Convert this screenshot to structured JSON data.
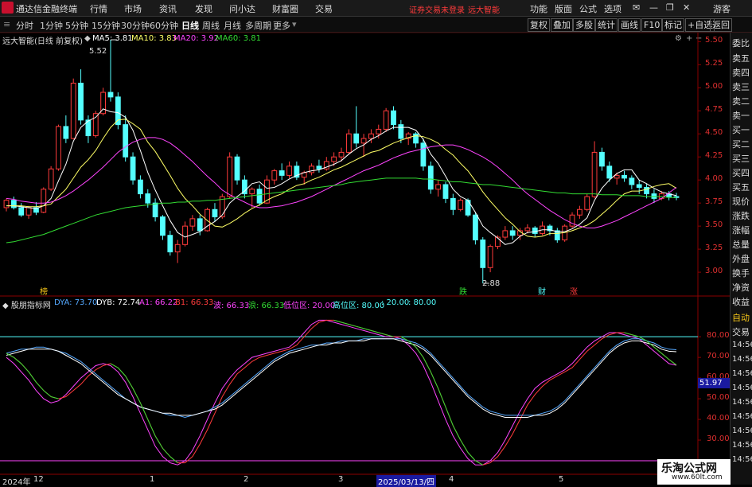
{
  "menubar": {
    "app_title": "通达信金融终端",
    "items": [
      "行情",
      "市场",
      "资讯",
      "发现",
      "问小达",
      "财富圈",
      "交易"
    ],
    "notice": "证券交易未登录",
    "stock_name": "远大智能",
    "right_items": [
      "功能",
      "版面",
      "公式",
      "选项"
    ],
    "user": "游客"
  },
  "toolbar": {
    "periods": [
      "分时",
      "1分钟",
      "5分钟",
      "15分钟",
      "30分钟",
      "60分钟",
      "日线",
      "周线",
      "月线",
      "多周期",
      "更多"
    ],
    "active": "日线",
    "right_buttons": [
      "复权",
      "叠加",
      "多股",
      "统计",
      "画线",
      "F10",
      "标记",
      "+自选",
      "返回"
    ]
  },
  "main_header": {
    "title": "远大智能(日线 前复权)",
    "ma5": "MA5: 3.81",
    "ma10": "MA10: 3.83",
    "ma20": "MA20: 3.92",
    "ma60": "MA60: 3.81"
  },
  "indicator_header": {
    "name": "股朋指标网",
    "dya": "DYA: 73.70",
    "dyb": "DYB: 72.74",
    "a1": "A1: 66.22",
    "b1": "B1: 66.33",
    "z1": "波: 66.33",
    "z2": "浪: 66.33",
    "low_zone": "低位区: 20.00",
    "high_zone": "高位区: 80.00",
    "v1": ": 20.00",
    "v2": ": 80.00"
  },
  "price_axis": [
    "5.50",
    "5.25",
    "5.00",
    "4.75",
    "4.50",
    "4.25",
    "4.00",
    "3.75",
    "3.50",
    "3.25",
    "3.00"
  ],
  "indicator_axis": [
    "80.00",
    "70.00",
    "60.00",
    "50.00",
    "40.00",
    "30.00"
  ],
  "indicator_current": "51.97",
  "annotations": {
    "high_label": "5.52",
    "low_label": "2.88",
    "tag1": "榜",
    "tag2": "跌",
    "tag3": "财",
    "tag4": "涨"
  },
  "date_axis": [
    "2024年",
    "12",
    "1",
    "2",
    "3",
    "2025/03/13/四",
    "4",
    "5"
  ],
  "right_panel": {
    "items": [
      "委比",
      "卖五",
      "卖四",
      "卖三",
      "卖二",
      "卖一",
      "买一",
      "买二",
      "买三",
      "买四",
      "买五",
      "现价",
      "涨跌",
      "涨幅",
      "总量",
      "外盘",
      "换手",
      "净资",
      "收益"
    ],
    "tabs": [
      "自动",
      "交易"
    ],
    "times": [
      "14:56",
      "14:56",
      "14:56",
      "14:56",
      "14:56",
      "14:56",
      "14:56",
      "14:56",
      "14:56"
    ]
  },
  "watermark": {
    "line1": "乐淘公式网",
    "line2": "www.60lt.com"
  },
  "colors": {
    "up": "#ff3b3b",
    "down": "#54ffff",
    "ma5": "#ffffff",
    "ma10": "#ffff66",
    "ma20": "#ff44ff",
    "ma60": "#33dd33"
  },
  "chart_data": {
    "type": "candlestick",
    "price_ylim": [
      2.88,
      5.52
    ],
    "ohlc": [
      [
        3.7,
        3.8,
        3.66,
        3.78
      ],
      [
        3.78,
        3.82,
        3.68,
        3.7
      ],
      [
        3.7,
        3.75,
        3.6,
        3.62
      ],
      [
        3.62,
        3.72,
        3.58,
        3.7
      ],
      [
        3.7,
        3.76,
        3.62,
        3.65
      ],
      [
        3.65,
        3.92,
        3.64,
        3.9
      ],
      [
        3.9,
        4.15,
        3.88,
        4.12
      ],
      [
        4.12,
        4.6,
        4.1,
        4.58
      ],
      [
        4.58,
        4.7,
        4.4,
        4.45
      ],
      [
        4.45,
        5.1,
        4.44,
        5.05
      ],
      [
        5.05,
        5.2,
        4.6,
        4.65
      ],
      [
        4.65,
        4.7,
        4.4,
        4.48
      ],
      [
        4.48,
        4.75,
        4.46,
        4.72
      ],
      [
        4.72,
        5.0,
        4.7,
        4.95
      ],
      [
        4.95,
        5.52,
        4.85,
        4.9
      ],
      [
        4.9,
        4.95,
        4.55,
        4.6
      ],
      [
        4.6,
        4.7,
        4.2,
        4.25
      ],
      [
        4.25,
        4.3,
        3.95,
        4.0
      ],
      [
        4.0,
        4.05,
        3.8,
        3.85
      ],
      [
        3.85,
        3.9,
        3.7,
        3.75
      ],
      [
        3.75,
        3.8,
        3.55,
        3.6
      ],
      [
        3.6,
        3.62,
        3.35,
        3.4
      ],
      [
        3.4,
        3.45,
        3.18,
        3.22
      ],
      [
        3.22,
        3.35,
        3.1,
        3.3
      ],
      [
        3.3,
        3.55,
        3.28,
        3.5
      ],
      [
        3.5,
        3.62,
        3.45,
        3.58
      ],
      [
        3.58,
        3.62,
        3.4,
        3.45
      ],
      [
        3.45,
        3.7,
        3.44,
        3.68
      ],
      [
        3.68,
        3.75,
        3.55,
        3.6
      ],
      [
        3.6,
        3.85,
        3.58,
        3.82
      ],
      [
        3.82,
        4.3,
        3.8,
        4.25
      ],
      [
        4.25,
        4.28,
        3.95,
        4.0
      ],
      [
        4.0,
        4.05,
        3.8,
        3.85
      ],
      [
        3.85,
        3.92,
        3.7,
        3.9
      ],
      [
        3.9,
        3.95,
        3.72,
        3.75
      ],
      [
        3.75,
        4.05,
        3.74,
        4.0
      ],
      [
        4.0,
        4.12,
        3.95,
        4.1
      ],
      [
        4.1,
        4.18,
        4.0,
        4.05
      ],
      [
        4.05,
        4.2,
        4.02,
        4.15
      ],
      [
        4.15,
        4.2,
        4.0,
        4.03
      ],
      [
        4.03,
        4.1,
        3.95,
        4.08
      ],
      [
        4.08,
        4.18,
        4.05,
        4.15
      ],
      [
        4.15,
        4.22,
        4.08,
        4.12
      ],
      [
        4.12,
        4.25,
        4.1,
        4.2
      ],
      [
        4.2,
        4.3,
        4.15,
        4.25
      ],
      [
        4.25,
        4.35,
        4.2,
        4.3
      ],
      [
        4.3,
        4.55,
        4.28,
        4.5
      ],
      [
        4.5,
        4.8,
        4.35,
        4.4
      ],
      [
        4.4,
        4.5,
        4.25,
        4.45
      ],
      [
        4.45,
        4.55,
        4.4,
        4.5
      ],
      [
        4.5,
        4.6,
        4.45,
        4.55
      ],
      [
        4.55,
        4.78,
        4.52,
        4.75
      ],
      [
        4.75,
        4.8,
        4.55,
        4.6
      ],
      [
        4.6,
        4.65,
        4.4,
        4.45
      ],
      [
        4.45,
        4.52,
        4.38,
        4.5
      ],
      [
        4.5,
        4.52,
        4.35,
        4.4
      ],
      [
        4.4,
        4.45,
        4.1,
        4.15
      ],
      [
        4.15,
        4.2,
        3.85,
        3.9
      ],
      [
        3.9,
        4.0,
        3.82,
        3.95
      ],
      [
        3.95,
        3.98,
        3.75,
        3.8
      ],
      [
        3.8,
        3.85,
        3.62,
        3.68
      ],
      [
        3.68,
        3.8,
        3.66,
        3.78
      ],
      [
        3.78,
        3.8,
        3.6,
        3.62
      ],
      [
        3.62,
        3.65,
        3.3,
        3.35
      ],
      [
        3.35,
        3.38,
        2.88,
        3.05
      ],
      [
        3.05,
        3.3,
        3.0,
        3.28
      ],
      [
        3.28,
        3.4,
        3.25,
        3.38
      ],
      [
        3.38,
        3.5,
        3.35,
        3.45
      ],
      [
        3.45,
        3.5,
        3.35,
        3.4
      ],
      [
        3.4,
        3.48,
        3.35,
        3.45
      ],
      [
        3.45,
        3.52,
        3.42,
        3.48
      ],
      [
        3.48,
        3.5,
        3.38,
        3.42
      ],
      [
        3.42,
        3.55,
        3.4,
        3.5
      ],
      [
        3.5,
        3.52,
        3.4,
        3.45
      ],
      [
        3.45,
        3.48,
        3.32,
        3.35
      ],
      [
        3.35,
        3.52,
        3.33,
        3.5
      ],
      [
        3.5,
        3.65,
        3.48,
        3.62
      ],
      [
        3.62,
        3.72,
        3.58,
        3.68
      ],
      [
        3.68,
        3.85,
        3.66,
        3.82
      ],
      [
        3.82,
        4.42,
        3.8,
        4.3
      ],
      [
        4.3,
        4.35,
        4.1,
        4.15
      ],
      [
        4.15,
        4.2,
        3.98,
        4.02
      ],
      [
        4.02,
        4.08,
        3.95,
        4.05
      ],
      [
        4.05,
        4.1,
        3.98,
        4.02
      ],
      [
        4.02,
        4.05,
        3.9,
        3.95
      ],
      [
        3.95,
        4.0,
        3.85,
        3.92
      ],
      [
        3.92,
        3.96,
        3.8,
        3.85
      ],
      [
        3.85,
        3.9,
        3.75,
        3.8
      ],
      [
        3.8,
        3.88,
        3.78,
        3.85
      ],
      [
        3.85,
        3.88,
        3.78,
        3.82
      ],
      [
        3.82,
        3.86,
        3.78,
        3.81
      ]
    ],
    "ma": {
      "MA5": [
        3.72,
        3.72,
        3.71,
        3.7,
        3.69,
        3.72,
        3.8,
        3.99,
        4.17,
        4.42,
        4.57,
        4.64,
        4.68,
        4.77,
        4.74,
        4.73,
        4.68,
        4.54,
        4.32,
        4.08,
        3.89,
        3.72,
        3.56,
        3.43,
        3.38,
        3.41,
        3.44,
        3.5,
        3.55,
        3.62,
        3.75,
        3.82,
        3.88,
        3.96,
        3.98,
        3.91,
        3.92,
        3.96,
        4.01,
        4.05,
        4.08,
        4.1,
        4.11,
        4.14,
        4.17,
        4.21,
        4.28,
        4.34,
        4.38,
        4.44,
        4.48,
        4.53,
        4.57,
        4.57,
        4.57,
        4.54,
        4.44,
        4.28,
        4.18,
        4.04,
        3.9,
        3.82,
        3.78,
        3.65,
        3.5,
        3.43,
        3.37,
        3.3,
        3.32,
        3.39,
        3.43,
        3.44,
        3.46,
        3.46,
        3.44,
        3.44,
        3.47,
        3.52,
        3.59,
        3.78,
        3.91,
        4.0,
        4.07,
        4.11,
        4.11,
        4.0,
        3.96,
        3.91,
        3.87,
        3.85,
        3.83
      ],
      "MA10": [
        3.72,
        3.72,
        3.72,
        3.71,
        3.71,
        3.72,
        3.74,
        3.82,
        3.9,
        4.02,
        4.14,
        4.22,
        4.32,
        4.45,
        4.57,
        4.65,
        4.66,
        4.61,
        4.55,
        4.41,
        4.31,
        4.18,
        4.05,
        3.91,
        3.8,
        3.72,
        3.63,
        3.56,
        3.5,
        3.49,
        3.53,
        3.58,
        3.64,
        3.69,
        3.73,
        3.78,
        3.82,
        3.85,
        3.9,
        3.94,
        3.96,
        4.0,
        4.03,
        4.07,
        4.11,
        4.14,
        4.18,
        4.22,
        4.26,
        4.3,
        4.32,
        4.36,
        4.4,
        4.43,
        4.46,
        4.48,
        4.47,
        4.44,
        4.4,
        4.33,
        4.27,
        4.18,
        4.1,
        3.99,
        3.87,
        3.77,
        3.68,
        3.59,
        3.52,
        3.44,
        3.39,
        3.38,
        3.39,
        3.42,
        3.42,
        3.43,
        3.45,
        3.48,
        3.51,
        3.56,
        3.63,
        3.7,
        3.78,
        3.85,
        3.88,
        3.88,
        3.9,
        3.93,
        3.95,
        3.96,
        3.91
      ],
      "MA20": [
        3.8,
        3.79,
        3.77,
        3.76,
        3.75,
        3.75,
        3.76,
        3.79,
        3.83,
        3.88,
        3.94,
        4.0,
        4.07,
        4.14,
        4.22,
        4.3,
        4.36,
        4.41,
        4.44,
        4.46,
        4.46,
        4.44,
        4.4,
        4.34,
        4.27,
        4.2,
        4.12,
        4.04,
        3.97,
        3.89,
        3.84,
        3.8,
        3.76,
        3.72,
        3.7,
        3.7,
        3.71,
        3.72,
        3.74,
        3.76,
        3.79,
        3.82,
        3.86,
        3.9,
        3.94,
        3.98,
        4.02,
        4.06,
        4.1,
        4.13,
        4.16,
        4.2,
        4.24,
        4.27,
        4.3,
        4.32,
        4.34,
        4.36,
        4.37,
        4.38,
        4.38,
        4.36,
        4.33,
        4.29,
        4.25,
        4.2,
        4.14,
        4.07,
        4.0,
        3.92,
        3.85,
        3.79,
        3.73,
        3.67,
        3.62,
        3.57,
        3.53,
        3.5,
        3.48,
        3.48,
        3.5,
        3.53,
        3.56,
        3.6,
        3.64,
        3.68,
        3.72,
        3.76,
        3.8,
        3.86,
        3.92
      ],
      "MA60": [
        3.32,
        3.33,
        3.35,
        3.37,
        3.39,
        3.41,
        3.44,
        3.47,
        3.5,
        3.53,
        3.56,
        3.59,
        3.62,
        3.64,
        3.66,
        3.68,
        3.7,
        3.71,
        3.72,
        3.73,
        3.74,
        3.75,
        3.75,
        3.76,
        3.76,
        3.77,
        3.77,
        3.78,
        3.78,
        3.79,
        3.8,
        3.81,
        3.82,
        3.83,
        3.84,
        3.85,
        3.86,
        3.87,
        3.88,
        3.89,
        3.9,
        3.91,
        3.92,
        3.93,
        3.94,
        3.95,
        3.97,
        3.98,
        3.99,
        4.0,
        4.01,
        4.02,
        4.02,
        4.02,
        4.02,
        4.02,
        4.01,
        4.01,
        4.0,
        3.99,
        3.98,
        3.98,
        3.97,
        3.96,
        3.95,
        3.95,
        3.94,
        3.93,
        3.92,
        3.91,
        3.9,
        3.89,
        3.88,
        3.87,
        3.86,
        3.86,
        3.85,
        3.85,
        3.85,
        3.85,
        3.84,
        3.84,
        3.84,
        3.83,
        3.83,
        3.83,
        3.82,
        3.82,
        3.82,
        3.81,
        3.81
      ]
    },
    "indicator_ylim": [
      15,
      92
    ],
    "indicator": {
      "DYA": [
        72,
        73,
        74,
        74,
        75,
        75,
        74,
        73,
        72,
        70,
        68,
        65,
        62,
        59,
        56,
        53,
        50,
        48,
        46,
        45,
        44,
        43,
        42,
        42,
        41,
        42,
        43,
        44,
        46,
        48,
        51,
        54,
        57,
        60,
        63,
        66,
        69,
        71,
        73,
        74,
        75,
        76,
        76,
        77,
        77,
        78,
        78,
        78,
        79,
        79,
        79,
        79,
        79,
        79,
        78,
        77,
        75,
        72,
        68,
        64,
        60,
        56,
        52,
        49,
        46,
        44,
        43,
        42,
        42,
        42,
        42,
        42,
        43,
        44,
        46,
        49,
        53,
        57,
        61,
        65,
        69,
        73,
        76,
        78,
        79,
        79,
        78,
        77,
        75,
        74,
        73.7
      ],
      "DYB": [
        71,
        72,
        73,
        74,
        74,
        74,
        74,
        73,
        71,
        69,
        67,
        64,
        61,
        58,
        55,
        52,
        50,
        48,
        46,
        45,
        44,
        43,
        43,
        42,
        42,
        42,
        43,
        44,
        45,
        47,
        50,
        53,
        56,
        59,
        62,
        65,
        68,
        70,
        72,
        73,
        74,
        75,
        76,
        76,
        77,
        77,
        78,
        78,
        78,
        79,
        79,
        79,
        79,
        78,
        77,
        76,
        74,
        71,
        67,
        63,
        59,
        55,
        51,
        48,
        45,
        43,
        42,
        41,
        41,
        41,
        41,
        42,
        42,
        43,
        45,
        48,
        52,
        56,
        60,
        64,
        68,
        72,
        75,
        77,
        78,
        78,
        77,
        76,
        74,
        73,
        72.74
      ],
      "A1": [
        70,
        67,
        63,
        59,
        54,
        50,
        48,
        49,
        52,
        56,
        60,
        63,
        66,
        67,
        66,
        63,
        58,
        51,
        43,
        35,
        27,
        22,
        19,
        18,
        20,
        25,
        32,
        40,
        48,
        55,
        60,
        64,
        67,
        70,
        71,
        72,
        73,
        74,
        75,
        78,
        82,
        86,
        88,
        88,
        87,
        86,
        85,
        84,
        83,
        82,
        81,
        80,
        80,
        79,
        76,
        72,
        66,
        58,
        49,
        40,
        32,
        26,
        21,
        18,
        18,
        20,
        24,
        30,
        37,
        44,
        50,
        55,
        58,
        60,
        62,
        64,
        67,
        71,
        75,
        78,
        80,
        82,
        82,
        81,
        80,
        79,
        76,
        73,
        70,
        67,
        66.22
      ],
      "B1": [
        72,
        70,
        67,
        63,
        58,
        54,
        51,
        50,
        51,
        54,
        57,
        61,
        64,
        66,
        67,
        65,
        61,
        55,
        48,
        40,
        32,
        26,
        22,
        19,
        19,
        22,
        28,
        35,
        43,
        51,
        57,
        62,
        65,
        68,
        70,
        71,
        72,
        73,
        74,
        76,
        80,
        84,
        87,
        88,
        88,
        87,
        86,
        85,
        84,
        83,
        82,
        81,
        80,
        80,
        78,
        75,
        70,
        63,
        55,
        46,
        37,
        30,
        24,
        20,
        18,
        19,
        22,
        27,
        33,
        40,
        47,
        52,
        56,
        59,
        61,
        63,
        65,
        69,
        73,
        76,
        79,
        81,
        82,
        82,
        81,
        80,
        78,
        75,
        72,
        69,
        66.33
      ]
    }
  }
}
